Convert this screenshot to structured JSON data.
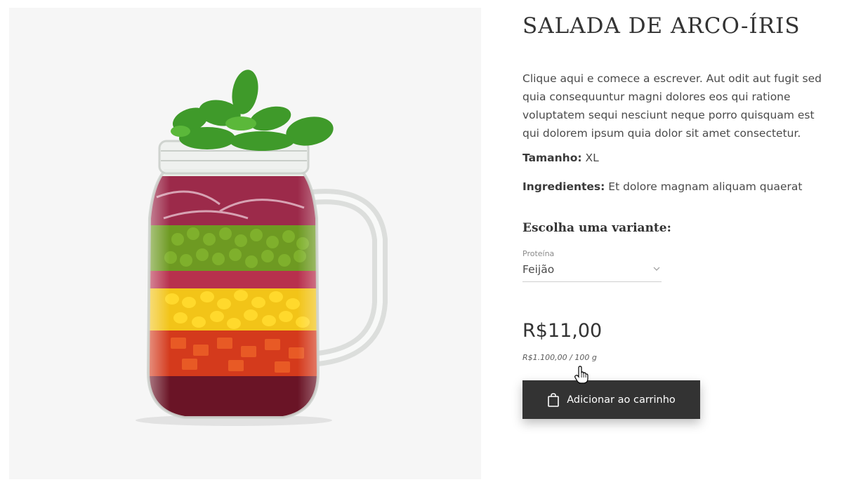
{
  "product": {
    "title": "SALADA DE ARCO-ÍRIS",
    "description": "Clique aqui e comece a escrever. Aut odit aut fugit sed quia consequuntur magni dolores eos qui ratione voluptatem sequi nesciunt neque porro quisquam est qui dolorem ipsum quia dolor sit amet consectetur.",
    "size_label": "Tamanho:",
    "size_value": "XL",
    "ingredients_label": "Ingredientes:",
    "ingredients_value": "Et dolore magnam aliquam quaerat"
  },
  "variant": {
    "heading": "Escolha uma variante:",
    "select_label": "Proteína",
    "selected_value": "Feijão"
  },
  "pricing": {
    "price": "R$11,00",
    "unit_price": "R$1.100,00 / 100 g"
  },
  "cart": {
    "button_label": "Adicionar ao carrinho",
    "icon": "shopping-bag-icon"
  },
  "image": {
    "subject": "salad-jar-image",
    "background": "#f6f6f6"
  },
  "colors": {
    "button_bg": "#333333",
    "text": "#3a3a3a"
  }
}
